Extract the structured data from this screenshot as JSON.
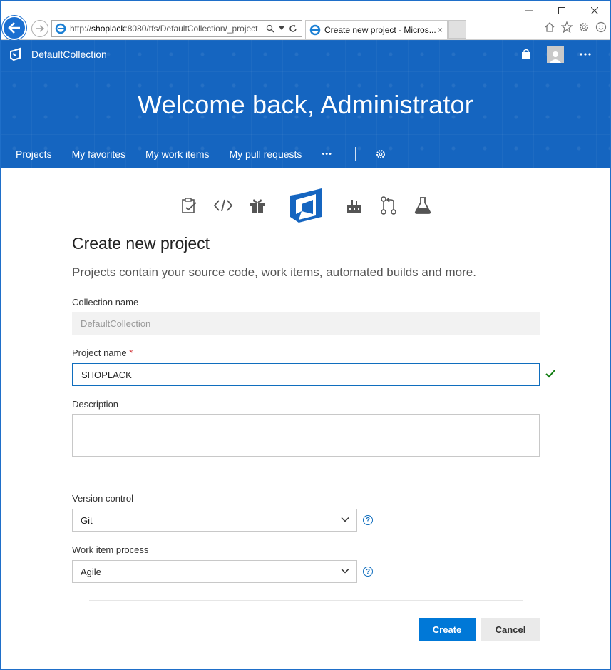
{
  "browser": {
    "url_prefix": "http://",
    "url_host": "shoplack",
    "url_rest": ":8080/tfs/DefaultCollection/_project",
    "tab_title": "Create new project - Micros...",
    "tab_close": "×"
  },
  "header": {
    "collection": "DefaultCollection",
    "welcome": "Welcome back, Administrator",
    "nav": [
      "Projects",
      "My favorites",
      "My work items",
      "My pull requests"
    ],
    "more": "•••"
  },
  "form": {
    "title": "Create new project",
    "subtitle": "Projects contain your source code, work items, automated builds and more.",
    "collection_label": "Collection name",
    "collection_value": "DefaultCollection",
    "project_label": "Project name",
    "required_mark": "*",
    "project_value": "SHOPLACK",
    "description_label": "Description",
    "version_control_label": "Version control",
    "version_control_value": "Git",
    "process_label": "Work item process",
    "process_value": "Agile",
    "help_glyph": "?",
    "create_label": "Create",
    "cancel_label": "Cancel"
  },
  "colors": {
    "brand_blue": "#1565c0",
    "primary_button": "#0078d7",
    "valid_green": "#107c10"
  }
}
